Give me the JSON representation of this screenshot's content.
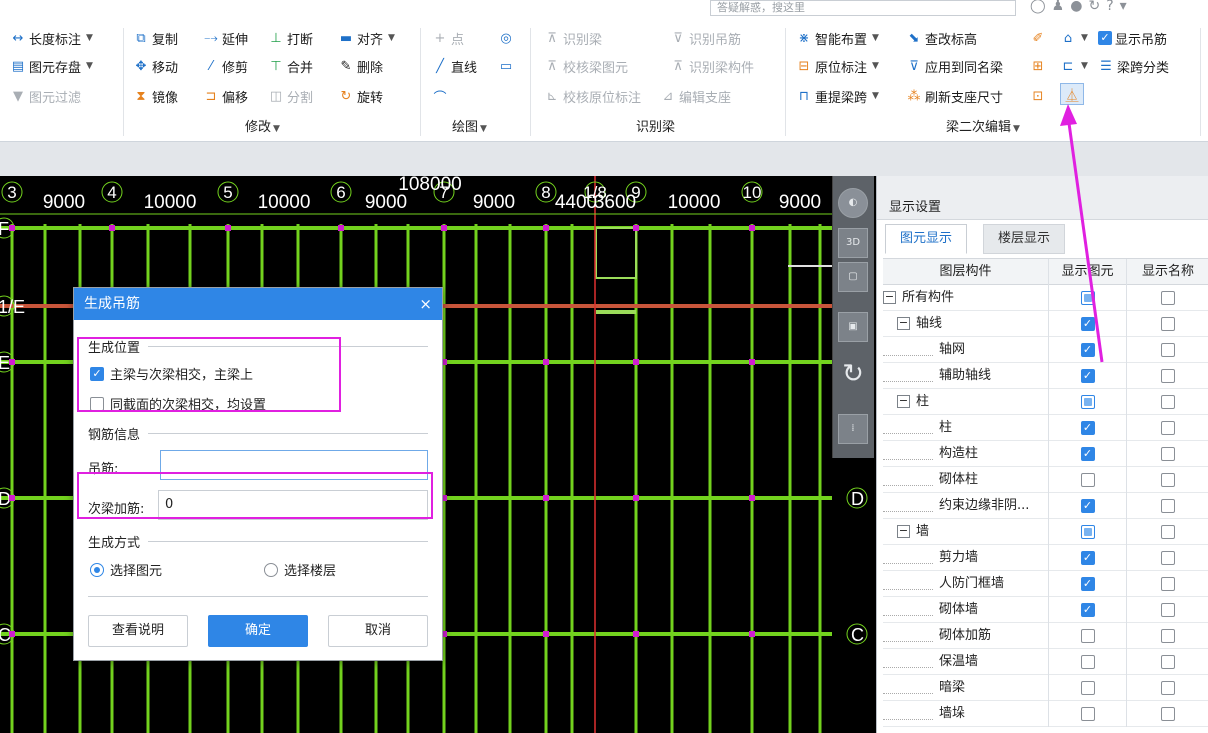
{
  "search": {
    "placeholder": "答疑解惑，搜这里"
  },
  "ribbon": {
    "col1": [
      "长度标注",
      "图元存盘",
      "图元过滤"
    ],
    "modify": [
      "复制",
      "延伸",
      "打断",
      "对齐",
      "移动",
      "修剪",
      "合并",
      "删除",
      "镜像",
      "偏移",
      "分割",
      "旋转"
    ],
    "modify_label": "修改",
    "draw": [
      "点",
      "直线"
    ],
    "draw_label": "绘图",
    "identify": [
      "识别梁",
      "识别吊筋",
      "校核梁图元",
      "识别梁构件",
      "校核原位标注",
      "编辑支座"
    ],
    "identify_label": "识别梁",
    "beam2": [
      "智能布置",
      "查改标高",
      "原位标注",
      "应用到同名梁",
      "重提梁跨",
      "刷新支座尺寸"
    ],
    "beam2_label": "梁二次编辑",
    "right": [
      "显示吊筋",
      "梁跨分类"
    ]
  },
  "axis": {
    "numbers": [
      "3",
      "4",
      "5",
      "6",
      "7",
      "8",
      "1/8",
      "9",
      "10"
    ],
    "dims": [
      "9000",
      "10000",
      "10000",
      "9000",
      "9000",
      "4400",
      "3600",
      "10000",
      "9000"
    ],
    "total": "108000",
    "rows": [
      "F",
      "1/E",
      "E",
      "D",
      "C"
    ]
  },
  "rightpanel": {
    "title": "显示设置",
    "tabs": [
      "图元显示",
      "楼层显示"
    ],
    "headers": [
      "图层构件",
      "显示图元",
      "显示名称"
    ],
    "rows": [
      {
        "label": "所有构件",
        "level": 0,
        "group": true,
        "show": "partial",
        "name": false
      },
      {
        "label": "轴线",
        "level": 1,
        "group": true,
        "show": "checked",
        "name": false
      },
      {
        "label": "轴网",
        "level": 2,
        "group": false,
        "show": "checked",
        "name": false
      },
      {
        "label": "辅助轴线",
        "level": 2,
        "group": false,
        "show": "checked",
        "name": false
      },
      {
        "label": "柱",
        "level": 1,
        "group": true,
        "show": "partial",
        "name": false
      },
      {
        "label": "柱",
        "level": 2,
        "group": false,
        "show": "checked",
        "name": false
      },
      {
        "label": "构造柱",
        "level": 2,
        "group": false,
        "show": "checked",
        "name": false
      },
      {
        "label": "砌体柱",
        "level": 2,
        "group": false,
        "show": "unchecked",
        "name": false
      },
      {
        "label": "约束边缘非阴...",
        "level": 2,
        "group": false,
        "show": "checked",
        "name": false
      },
      {
        "label": "墙",
        "level": 1,
        "group": true,
        "show": "partial",
        "name": false
      },
      {
        "label": "剪力墙",
        "level": 2,
        "group": false,
        "show": "checked",
        "name": false
      },
      {
        "label": "人防门框墙",
        "level": 2,
        "group": false,
        "show": "checked",
        "name": false
      },
      {
        "label": "砌体墙",
        "level": 2,
        "group": false,
        "show": "checked",
        "name": false
      },
      {
        "label": "砌体加筋",
        "level": 2,
        "group": false,
        "show": "unchecked",
        "name": false
      },
      {
        "label": "保温墙",
        "level": 2,
        "group": false,
        "show": "unchecked",
        "name": false
      },
      {
        "label": "暗梁",
        "level": 2,
        "group": false,
        "show": "unchecked",
        "name": false
      },
      {
        "label": "墙垛",
        "level": 2,
        "group": false,
        "show": "unchecked",
        "name": false
      }
    ]
  },
  "dialog": {
    "title": "生成吊筋",
    "close": "×",
    "position_label": "生成位置",
    "opt1": "主梁与次梁相交，主梁上",
    "opt1_checked": true,
    "opt2": "同截面的次梁相交，均设置",
    "opt2_checked": false,
    "rebar_label": "钢筋信息",
    "hanger_label": "吊筋:",
    "hanger_value": "",
    "secondary_label": "次梁加筋:",
    "secondary_value": "0",
    "method_label": "生成方式",
    "method1": "选择图元",
    "method2": "选择楼层",
    "method_selected": "选择图元",
    "btn_help": "查看说明",
    "btn_ok": "确定",
    "btn_cancel": "取消"
  }
}
